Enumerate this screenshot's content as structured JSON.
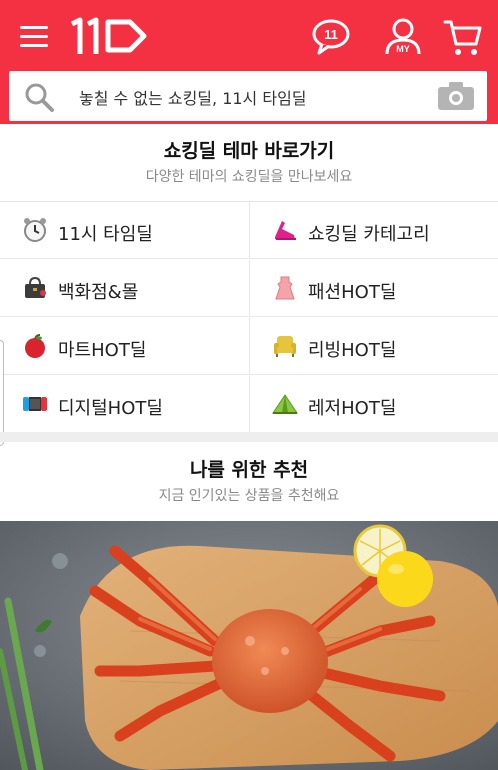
{
  "header": {
    "logo_text": "11",
    "talk_badge": "11",
    "my_label": "MY"
  },
  "search": {
    "placeholder": "놓칠 수 없는 쇼킹딜, 11시 타임딜"
  },
  "theme_section": {
    "title": "쇼킹딜 테마 바로가기",
    "subtitle": "다양한 테마의 쇼킹딜을 만나보세요",
    "items": [
      {
        "label": "11시 타임딜",
        "icon": "alarm-clock-icon"
      },
      {
        "label": "쇼킹딜 카테고리",
        "icon": "shoe-icon"
      },
      {
        "label": "백화점&몰",
        "icon": "handbag-icon"
      },
      {
        "label": "패션HOT딜",
        "icon": "dress-icon"
      },
      {
        "label": "마트HOT딜",
        "icon": "apple-icon"
      },
      {
        "label": "리빙HOT딜",
        "icon": "armchair-icon"
      },
      {
        "label": "디지털HOT딜",
        "icon": "game-console-icon"
      },
      {
        "label": "레저HOT딜",
        "icon": "tent-icon"
      }
    ]
  },
  "recommend_section": {
    "title": "나를 위한 추천",
    "subtitle": "지금 인기있는 상품을 추천해요"
  },
  "colors": {
    "brand_red": "#f43142",
    "subtitle_gray": "#8a8a8a"
  }
}
